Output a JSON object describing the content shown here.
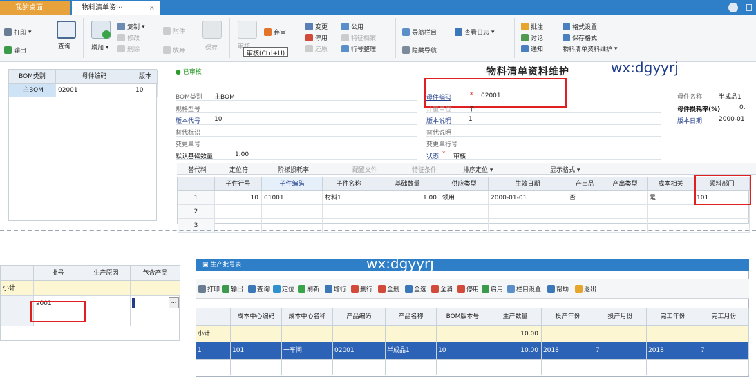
{
  "tabs": {
    "desktop": "我的桌面",
    "active": "物料清单资···",
    "close": "×"
  },
  "ribbon": {
    "print": "打印",
    "output": "输出",
    "query": "查询",
    "add": "增加",
    "copy": "复制",
    "modify": "修改",
    "delete": "删除",
    "attach": "附件",
    "abandon": "放弃",
    "save": "保存",
    "audit": "审核",
    "reject": "弃审",
    "change": "变更",
    "stop": "停用",
    "restore": "还原",
    "public": "公用",
    "feature_file": "特征档案",
    "row_organize": "行号整理",
    "nav_bar": "导航栏目",
    "view_log": "查看日志",
    "hide_nav": "隐藏导航",
    "annotate": "批注",
    "discuss": "讨论",
    "notify": "通知",
    "format_settings": "格式设置",
    "save_format": "保存格式",
    "bom_maint": "物料清单资料维护",
    "tooltip": "审核(Ctrl+U)"
  },
  "left_grid": {
    "headers": [
      "BOM类别",
      "母件编码",
      "版本"
    ],
    "rows": [
      [
        "主BOM",
        "02001",
        "10"
      ]
    ]
  },
  "form": {
    "status": "已审核",
    "title": "物料清单资料维护",
    "watermark": "wx:dgyyrj",
    "fields": {
      "bom_type_label": "BOM类别",
      "bom_type_value": "主BOM",
      "spec_label": "规格型号",
      "version_code_label": "版本代号",
      "version_code_value": "10",
      "replace_flag_label": "替代标识",
      "change_no_label": "变更单号",
      "default_qty_label": "默认基础数量",
      "default_qty_value": "1.00",
      "parent_code_label": "母件编码",
      "parent_code_value": "02001",
      "unit_label": "计量单位",
      "unit_value": "个",
      "version_desc_label": "版本说明",
      "version_desc_value": "1",
      "replace_desc_label": "替代说明",
      "change_row_label": "变更单行号",
      "state_label": "状态",
      "state_value": "审核",
      "parent_name_label": "母件名称",
      "parent_name_value": "半成品1",
      "loss_rate_label": "母件损耗率(%)",
      "loss_rate_value": "0.",
      "version_date_label": "版本日期",
      "version_date_value": "2000-01"
    }
  },
  "detail_tabs": [
    "替代料",
    "定位符",
    "阶梯损耗率",
    "配置文件",
    "特征条件",
    "排序定位",
    "显示格式"
  ],
  "detail_grid": {
    "headers": [
      "子件行号",
      "子件编码",
      "子件名称",
      "基础数量",
      "供应类型",
      "生效日期",
      "产出品",
      "产出类型",
      "成本相关",
      "领料部门"
    ],
    "rows": [
      {
        "idx": "1",
        "cells": [
          "10",
          "01001",
          "材料1",
          "1.00",
          "领用",
          "2000-01-01",
          "否",
          "",
          "是",
          "101"
        ]
      },
      {
        "idx": "2",
        "cells": [
          "",
          "",
          "",
          "",
          "",
          "",
          "",
          "",
          "",
          ""
        ]
      },
      {
        "idx": "3",
        "cells": [
          "",
          "",
          "",
          "",
          "",
          "",
          "",
          "",
          "",
          ""
        ]
      }
    ]
  },
  "batch_grid": {
    "headers": [
      "批号",
      "生产原因",
      "包含产品"
    ],
    "subtotal": "小计",
    "value": "a001"
  },
  "batch_window": {
    "title": "生产批号表",
    "watermark": "wx:dgyyrj",
    "toolbar": [
      "打印",
      "输出",
      "查询",
      "定位",
      "刷新",
      "增行",
      "删行",
      "全删",
      "全选",
      "全消",
      "停用",
      "启用",
      "栏目设置",
      "帮助",
      "退出"
    ],
    "headers": [
      "成本中心编码",
      "成本中心名称",
      "产品编码",
      "产品名称",
      "BOM版本号",
      "生产数量",
      "投产年份",
      "投产月份",
      "完工年份",
      "完工月份"
    ],
    "subtotal": {
      "label": "小计",
      "qty": "10.00"
    },
    "rows": [
      [
        "101",
        "一车间",
        "02001",
        "半成品1",
        "10",
        "10.00",
        "2018",
        "7",
        "2018",
        "7"
      ]
    ],
    "row_index": "1"
  },
  "colors": {
    "brand_blue": "#2e7ec8",
    "highlight_red": "#e02020",
    "selected_row": "#2d63b6",
    "subtotal_bg": "#fdf6d2"
  }
}
